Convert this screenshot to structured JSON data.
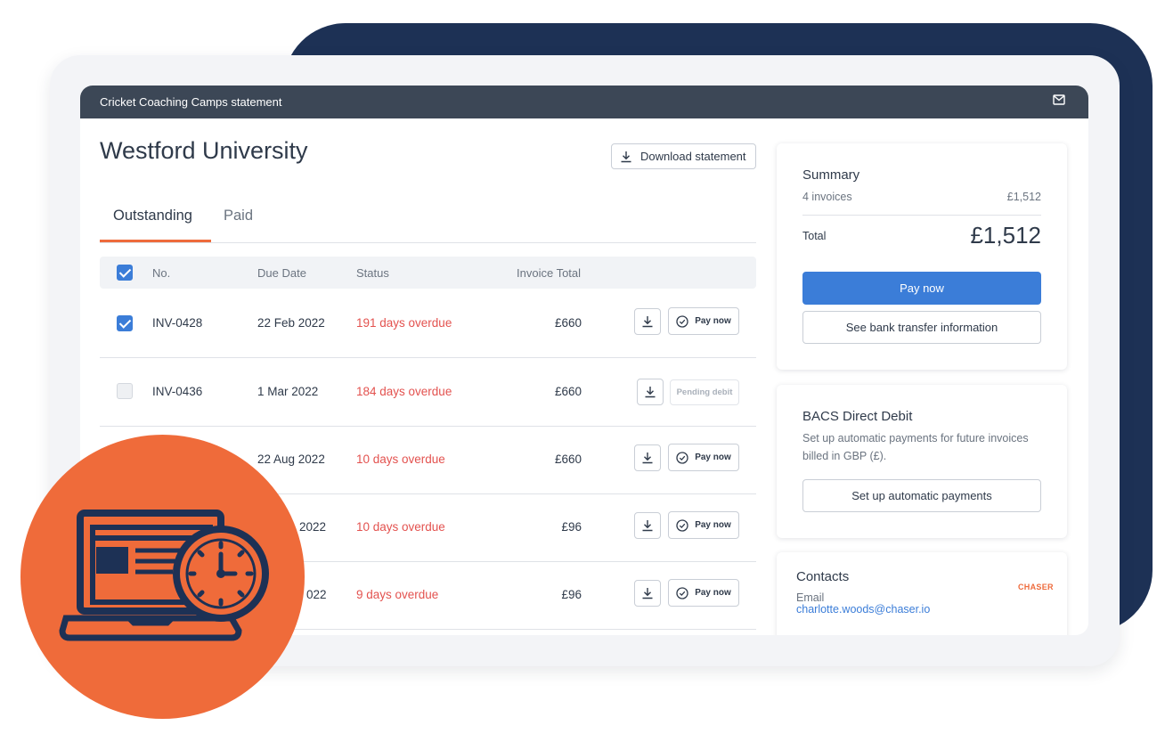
{
  "window": {
    "title": "Cricket Coaching Camps statement",
    "mail_icon": "mail-icon"
  },
  "customer": {
    "name": "Westford University"
  },
  "download_statement": {
    "label": "Download statement",
    "icon": "download-icon"
  },
  "tabs": [
    {
      "label": "Outstanding",
      "active": true
    },
    {
      "label": "Paid",
      "active": false
    }
  ],
  "table": {
    "header_checked": true,
    "columns": [
      "No.",
      "Due Date",
      "Status",
      "Invoice Total"
    ],
    "rows": [
      {
        "checked": true,
        "no": "INV-0428",
        "due_date": "22 Feb 2022",
        "status": "191 days overdue",
        "total": "£660",
        "action": "Pay now"
      },
      {
        "checked": false,
        "no": "INV-0436",
        "due_date": "1 Mar 2022",
        "status": "184 days overdue",
        "total": "£660",
        "action": "Pending debit"
      },
      {
        "checked": false,
        "no": "",
        "due_date": "22 Aug 2022",
        "status": "10 days overdue",
        "total": "£660",
        "action": "Pay now"
      },
      {
        "checked": false,
        "no": "",
        "due_date": "2022",
        "status": "10 days overdue",
        "total": "£96",
        "action": "Pay now"
      },
      {
        "checked": false,
        "no": "",
        "due_date": "022",
        "status": "9 days overdue",
        "total": "£96",
        "action": "Pay now"
      }
    ]
  },
  "summary": {
    "title": "Summary",
    "invoice_count": "4 invoices",
    "invoice_amount": "£1,512",
    "total_label": "Total",
    "total_amount": "£1,512",
    "pay_now_label": "Pay now",
    "bank_transfer_label": "See bank transfer information"
  },
  "bacs": {
    "title": "BACS Direct Debit",
    "description": "Set up automatic payments for future invoices billed in GBP (£).",
    "button_label": "Set up automatic payments"
  },
  "contacts": {
    "title": "Contacts",
    "email_label": "Email",
    "email": "charlotte.woods@chaser.io",
    "logo_text": "CHASER"
  },
  "colors": {
    "navy": "#1d3155",
    "accent_orange": "#ee6b3c",
    "primary_blue": "#3b7dd8",
    "overdue_red": "#e3524f",
    "topbar": "#3c4756"
  },
  "badge_icon": "laptop-clock-icon"
}
